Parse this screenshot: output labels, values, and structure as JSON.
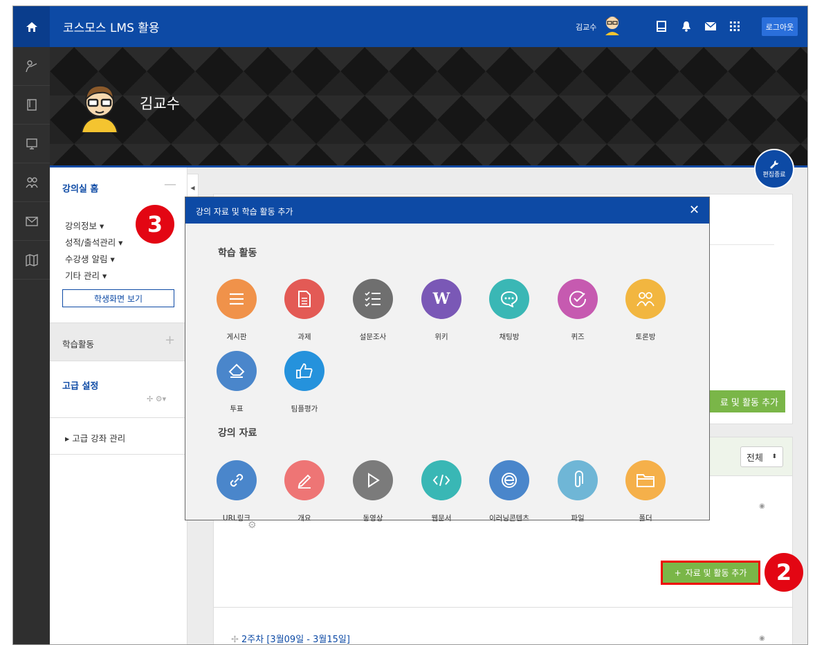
{
  "header": {
    "title": "코스모스 LMS 활용",
    "user_name": "김교수",
    "logout_label": "로그아웃"
  },
  "hero": {
    "name": "김교수",
    "edit_badge": "편집종료"
  },
  "sidebar": {
    "home": "강의실 홈",
    "items": [
      "강의정보 ▾",
      "성적/출석관리 ▾",
      "수강생 알림 ▾",
      "기타 관리 ▾"
    ],
    "student_view_button": "학생화면 보기",
    "activity": "학습활동",
    "advanced": "고급 설정",
    "course_manage": "▸  고급 강좌 관리"
  },
  "content": {
    "add_button_back": "료 및 활동 추가",
    "filter_select": "전체",
    "add_button_main": "자료 및 활동 추가",
    "week_link": "2주차 [3월09일 - 3월15일]"
  },
  "modal": {
    "title": "강의 자료 및 학습 활동 추가",
    "section_activities": "학습 활동",
    "section_resources": "강의 자료",
    "activities": [
      {
        "label": "게시판",
        "icon": "list-icon",
        "color": "#f0924a"
      },
      {
        "label": "과제",
        "icon": "document-icon",
        "color": "#e35a55"
      },
      {
        "label": "설문조사",
        "icon": "checklist-icon",
        "color": "#6f6f6f"
      },
      {
        "label": "위키",
        "icon": "wiki-icon",
        "color": "#7a58b6"
      },
      {
        "label": "채팅방",
        "icon": "chat-icon",
        "color": "#3ab7b5"
      },
      {
        "label": "퀴즈",
        "icon": "check-circle-icon",
        "color": "#c65ab0"
      },
      {
        "label": "토론방",
        "icon": "people-icon",
        "color": "#f2b640"
      },
      {
        "label": "투표",
        "icon": "eraser-icon",
        "color": "#4a86cb"
      },
      {
        "label": "팀플평가",
        "icon": "thumbs-up-icon",
        "color": "#2592dc"
      }
    ],
    "resources": [
      {
        "label": "URL링크",
        "icon": "link-icon",
        "color": "#4a86cb"
      },
      {
        "label": "개요",
        "icon": "pencil-icon",
        "color": "#ee7575"
      },
      {
        "label": "동영상",
        "icon": "play-icon",
        "color": "#7b7b7b"
      },
      {
        "label": "웹문서",
        "icon": "code-icon",
        "color": "#39b7b5"
      },
      {
        "label": "이러닝콘텐츠",
        "icon": "e-learning-icon",
        "color": "#4a86cb"
      },
      {
        "label": "파일",
        "icon": "paperclip-icon",
        "color": "#6fb6d6"
      },
      {
        "label": "폴더",
        "icon": "folder-icon",
        "color": "#f5b04a"
      }
    ]
  },
  "annotations": {
    "step2": "2",
    "step3": "3"
  }
}
